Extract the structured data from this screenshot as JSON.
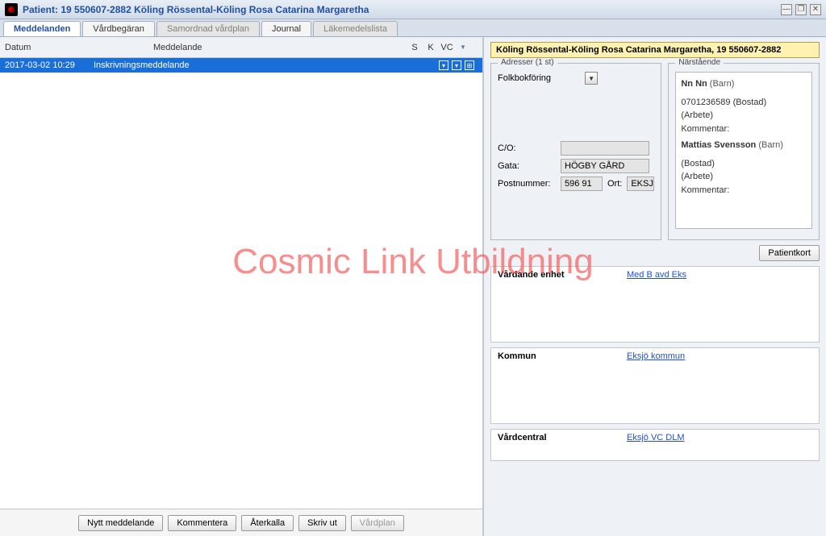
{
  "window": {
    "title": "Patient: 19 550607-2882 Köling Rössental-Köling Rosa Catarina Margaretha"
  },
  "tabs": {
    "meddelanden": "Meddelanden",
    "vardbegaran": "Vårdbegäran",
    "samordnad": "Samordnad vårdplan",
    "journal": "Journal",
    "lakemedel": "Läkemedelslista"
  },
  "msg_header": {
    "datum": "Datum",
    "meddelande": "Meddelande",
    "s": "S",
    "k": "K",
    "vc": "VC"
  },
  "msg_row": {
    "datum": "2017-03-02 10:29",
    "text": "Inskrivningsmeddelande"
  },
  "buttons": {
    "nytt": "Nytt meddelande",
    "kommentera": "Kommentera",
    "aterkalla": "Återkalla",
    "skrivut": "Skriv ut",
    "vardplan": "Vårdplan",
    "patientkort": "Patientkort"
  },
  "patient_header": "Köling Rössental-Köling Rosa Catarina Margaretha, 19 550607-2882",
  "adresser": {
    "legend": "Adresser (1 st)",
    "folkbokforing": "Folkbokföring",
    "co_label": "C/O:",
    "co_value": "",
    "gata_label": "Gata:",
    "gata_value": "HÖGBY GÅRD",
    "postnr_label": "Postnummer:",
    "postnr_value": "596 91",
    "ort_label": "Ort:",
    "ort_value": "EKSJ"
  },
  "narstaende": {
    "legend": "Närstående",
    "items": [
      {
        "name": "Nn Nn",
        "type": "(Barn)",
        "phone": "0701236589 (Bostad)",
        "work": "(Arbete)",
        "comment": "Kommentar:"
      },
      {
        "name": "Mattias Svensson",
        "type": "(Barn)",
        "phone": "(Bostad)",
        "work": "(Arbete)",
        "comment": "Kommentar:"
      }
    ]
  },
  "sections": {
    "vardande": {
      "label": "Vårdande enhet",
      "link": "Med B avd Eks"
    },
    "kommun": {
      "label": "Kommun",
      "link": "Eksjö kommun"
    },
    "vardcentral": {
      "label": "Vårdcentral",
      "link": "Eksjö VC DLM"
    }
  },
  "watermark": "Cosmic Link Utbildning"
}
